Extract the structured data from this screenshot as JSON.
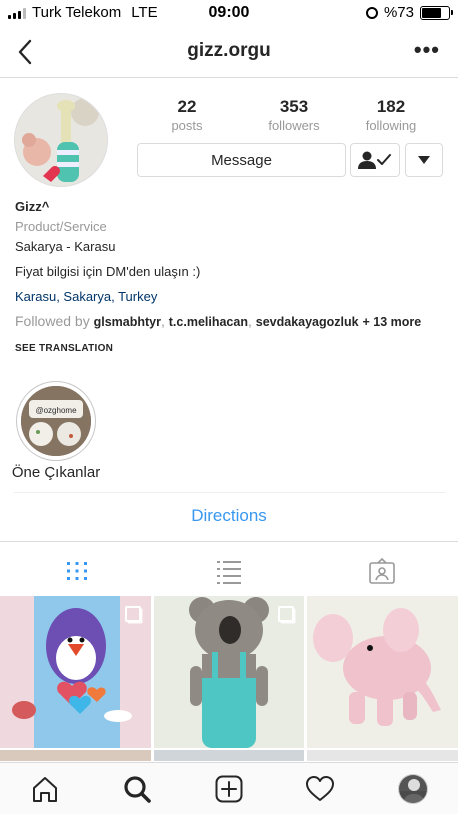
{
  "status_bar": {
    "carrier": "Turk Telekom",
    "network": "LTE",
    "time": "09:00",
    "battery": "%73",
    "battery_level": 0.73
  },
  "nav": {
    "title": "gizz.orgu",
    "back_icon": "chevron-left-icon",
    "more_icon": "more-horizontal-icon"
  },
  "stats": [
    {
      "value": "22",
      "label": "posts"
    },
    {
      "value": "353",
      "label": "followers"
    },
    {
      "value": "182",
      "label": "following"
    }
  ],
  "actions": {
    "message": "Message",
    "following_icon": "user-check-icon",
    "dropdown_icon": "caret-down-icon"
  },
  "bio": {
    "name": "Gizz^",
    "category": "Product/Service",
    "location_text": "Sakarya - Karasu",
    "description": "Fiyat bilgisi için DM'den ulaşın :)",
    "address_link": "Karasu, Sakarya, Turkey",
    "followed_by_prefix": "Followed by",
    "followed_users": [
      "glsmabhtyr",
      "t.c.melihacan",
      "sevdakayagozluk"
    ],
    "followed_more": "+ 13 more",
    "see_translation": "SEE TRANSLATION"
  },
  "highlight": {
    "label": "Öne Çıkanlar",
    "cover_text": "@ozghome"
  },
  "directions": "Directions",
  "tabs": [
    "grid-icon",
    "list-icon",
    "tagged-icon"
  ],
  "posts": [
    {
      "subject": "crochet penguin with hearts",
      "multi": true
    },
    {
      "subject": "crochet koala in turquoise overalls",
      "multi": true
    },
    {
      "subject": "crochet pink elephant",
      "multi": false
    }
  ],
  "bottom_nav": [
    "home-icon",
    "search-icon",
    "add-icon",
    "heart-icon",
    "profile-avatar"
  ],
  "colors": {
    "link_blue": "#3897f0",
    "bio_link": "#003569",
    "text": "#262626",
    "muted": "#999999",
    "border": "#dbdbdb"
  }
}
